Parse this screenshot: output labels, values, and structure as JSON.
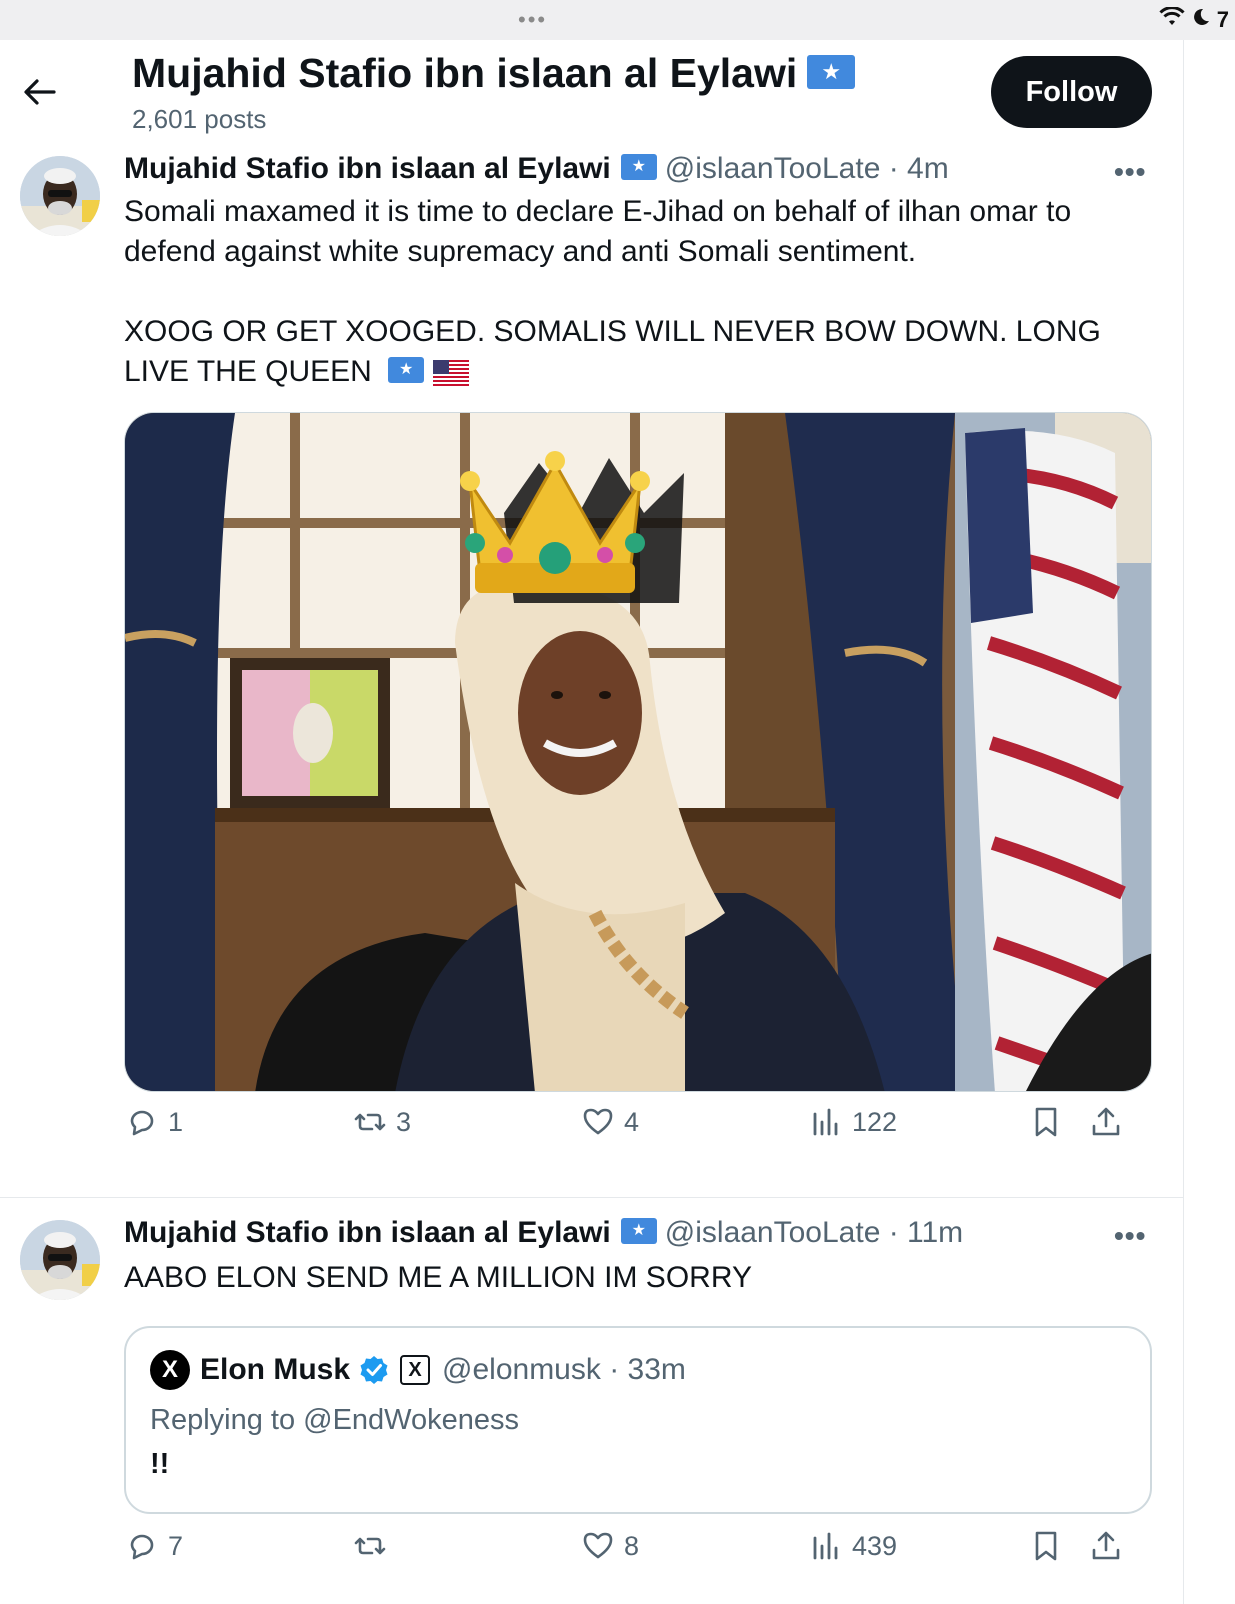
{
  "status_bar": {
    "dots": "•••",
    "time_fragment": "7"
  },
  "header": {
    "title": "Mujahid Stafio ibn islaan al Eylawi",
    "flag_badge": "★",
    "post_count": "2,601 posts",
    "follow_label": "Follow",
    "back_icon": "arrow-left-icon"
  },
  "tweets": [
    {
      "author": "Mujahid Stafio ibn islaan al Eylawi",
      "flag": "★",
      "handle": "@islaanTooLate · 4m",
      "more": "•••",
      "text_paragraphs": [
        "Somali maxamed it is time to declare E-Jihad on behalf of ilhan omar to defend against white supremacy and anti Somali sentiment.",
        "XOOG OR GET XOOGED. SOMALIS WILL NEVER BOW DOWN. LONG LIVE THE QUEEN"
      ],
      "stats": {
        "replies": "1",
        "reposts": "3",
        "likes": "4",
        "views": "122"
      }
    },
    {
      "author": "Mujahid Stafio ibn islaan al Eylawi",
      "flag": "★",
      "handle": "@islaanTooLate · 11m",
      "more": "•••",
      "text": "AABO ELON SEND ME A MILLION IM SORRY",
      "quote": {
        "avatar_letter": "X",
        "author": "Elon Musk",
        "badge_letter": "X",
        "handle": "@elonmusk · 33m",
        "replying_to": "Replying to @EndWokeness",
        "text": "!!"
      },
      "stats": {
        "replies": "7",
        "reposts": "",
        "likes": "8",
        "views": "439"
      }
    }
  ],
  "colors": {
    "text_primary": "#0f1419",
    "text_secondary": "#536471",
    "somalia_blue": "#4189dd",
    "verified_blue": "#1d9bf0",
    "status_bar_bg": "#efeff1"
  }
}
